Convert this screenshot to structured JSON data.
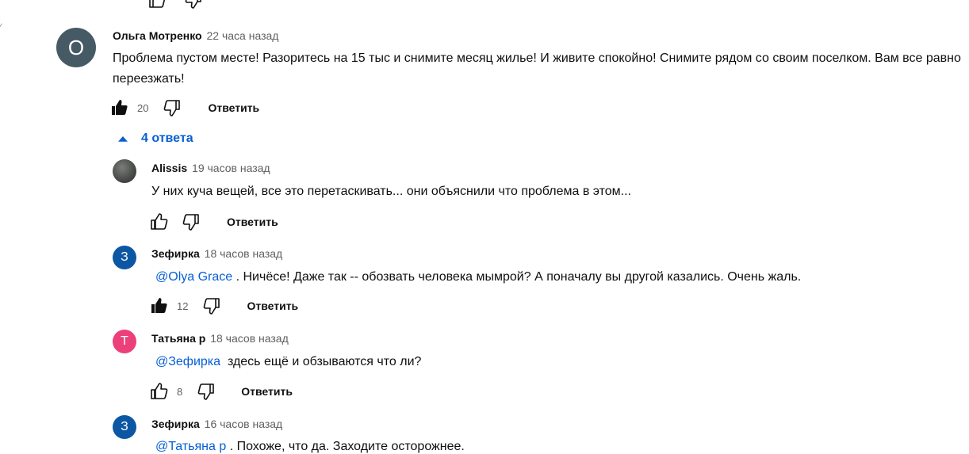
{
  "comments": [
    {
      "author": "Ольга Мотренко",
      "time": "22 часа назад",
      "avatar_letter": "О",
      "avatar_color": "#455a64",
      "text": "Проблема пустом месте! Разоритесь на 15 тыс и снимите месяц жилье! И живите спокойно! Снимите рядом со своим поселком. Вам все равно переезжать!",
      "likes": "20",
      "reply_label": "Ответить",
      "liked": true
    }
  ],
  "replies_toggle_label": "4 ответа",
  "replies": [
    {
      "author": "Alissis",
      "time": "19 часов назад",
      "text": "У них куча вещей, все это перетаскивать... они  объяснили что проблема в этом...",
      "likes": "",
      "reply_label": "Ответить",
      "liked": false
    },
    {
      "author": "Зефирка",
      "time": "18 часов назад",
      "avatar_letter": "З",
      "avatar_color": "#0b57a4",
      "mention": "@Olya Grace",
      "text": " . Ничёсе! Даже так -- обозвать человека мымрой? А поначалу вы другой казались. Очень жаль.",
      "likes": "12",
      "reply_label": "Ответить",
      "liked": true
    },
    {
      "author": "Татьяна р",
      "time": "18 часов назад",
      "avatar_letter": "Т",
      "avatar_color": "#ec407a",
      "mention": "@Зефирка",
      "text": "  здесь ещё и обзываются что ли?",
      "likes": "8",
      "reply_label": "Ответить",
      "liked": false
    },
    {
      "author": "Зефирка",
      "time": "16 часов назад",
      "avatar_letter": "З",
      "avatar_color": "#0b57a4",
      "mention": "@Татьяна р",
      "text": " . Похоже, что да. Заходите осторожнее."
    }
  ]
}
